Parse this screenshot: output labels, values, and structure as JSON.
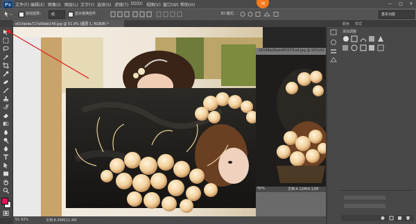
{
  "app": {
    "logo": "Ps"
  },
  "menu": {
    "items": [
      "文件(F)",
      "编辑(E)",
      "图像(I)",
      "图层(L)",
      "文字(Y)",
      "选择(S)",
      "滤镜(T)",
      "3D(D)",
      "视图(V)",
      "窗口(W)",
      "帮助(H)"
    ]
  },
  "badge": "76",
  "window_buttons": [
    "—",
    "□",
    "✕"
  ],
  "options": {
    "auto_select_label": "自动选择：",
    "auto_select_value": "组",
    "show_transform_label": "显示变换控件",
    "mode_3d_label": "3D 模式：",
    "workspace": "基本功能"
  },
  "tabs": {
    "doc1": "e01faeda717a0bbb149.jpg @ 51.9% (图层 1, RGB/8) *",
    "doc2": "16148a28aed6537f1a4.jpg @ 50%(RGB/8)"
  },
  "panels": {
    "tab1": "颜色",
    "tab2": "样式",
    "adjust_title": "添加调整"
  },
  "status": {
    "main_zoom": "51.93%",
    "main_doc": "文档:8.49M/11.4M",
    "win2_zoom": "50%",
    "win2_doc": "文档:4.12M/4.12M"
  },
  "colors": {
    "foreground": "#e0125c",
    "background": "#ffffff",
    "annotation": "#e11d1d"
  },
  "icons": [
    "move-tool-icon",
    "marquee-tool-icon",
    "lasso-tool-icon",
    "magic-wand-icon",
    "crop-tool-icon",
    "eyedropper-icon",
    "healing-brush-icon",
    "brush-icon",
    "clone-stamp-icon",
    "history-brush-icon",
    "eraser-icon",
    "gradient-icon",
    "blur-icon",
    "dodge-icon",
    "pen-icon",
    "type-icon",
    "path-select-icon",
    "shape-icon",
    "hand-icon",
    "zoom-icon"
  ]
}
